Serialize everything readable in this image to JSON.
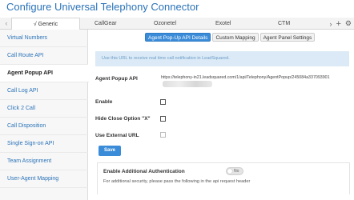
{
  "header": {
    "title": "Configure Universal Telephony Connector"
  },
  "tabs": {
    "prev_icon": "chevron-left-icon",
    "next_icon": "chevron-right-icon",
    "items": [
      {
        "label": "√ Generic",
        "active": true
      },
      {
        "label": "CallGear",
        "active": false
      },
      {
        "label": "Ozonetel",
        "active": false
      },
      {
        "label": "Exotel",
        "active": false
      },
      {
        "label": "CTM",
        "active": false
      }
    ],
    "add_icon": "plus-icon",
    "settings_icon": "gear-icon"
  },
  "sidebar": {
    "items": [
      {
        "label": "Virtual Numbers",
        "active": false
      },
      {
        "label": "Call Route API",
        "active": false
      },
      {
        "label": "Agent Popup API",
        "active": true
      },
      {
        "label": "Call Log API",
        "active": false
      },
      {
        "label": "Click 2 Call",
        "active": false
      },
      {
        "label": "Call Disposition",
        "active": false
      },
      {
        "label": "Single Sign-on API",
        "active": false
      },
      {
        "label": "Team Assignment",
        "active": false
      },
      {
        "label": "User-Agent Mapping",
        "active": false
      }
    ]
  },
  "main": {
    "subtabs": [
      {
        "label": "Agent Pop-Up API Details",
        "active": true
      },
      {
        "label": "Custom Mapping",
        "active": false
      },
      {
        "label": "Agent Panel Settings",
        "active": false
      }
    ],
    "info_text": "Use this URL to receive real time call notification in LeadSquared.",
    "api_label": "Agent Popup API",
    "api_url": "https://telephony-in21.leadsquared.com/1/api/Telephony/AgentPopup/245084a337093901",
    "fields": {
      "enable": {
        "label": "Enable",
        "checked": false
      },
      "hide_close": {
        "label": "Hide Close Option \"X\"",
        "checked": false
      },
      "external_url": {
        "label": "Use External URL",
        "checked": false,
        "disabled": true
      }
    },
    "save_label": "Save",
    "auth": {
      "title": "Enable Additional Authentication",
      "toggle_state": "No",
      "description": "For additional security, please pass the following in the api request header"
    }
  }
}
